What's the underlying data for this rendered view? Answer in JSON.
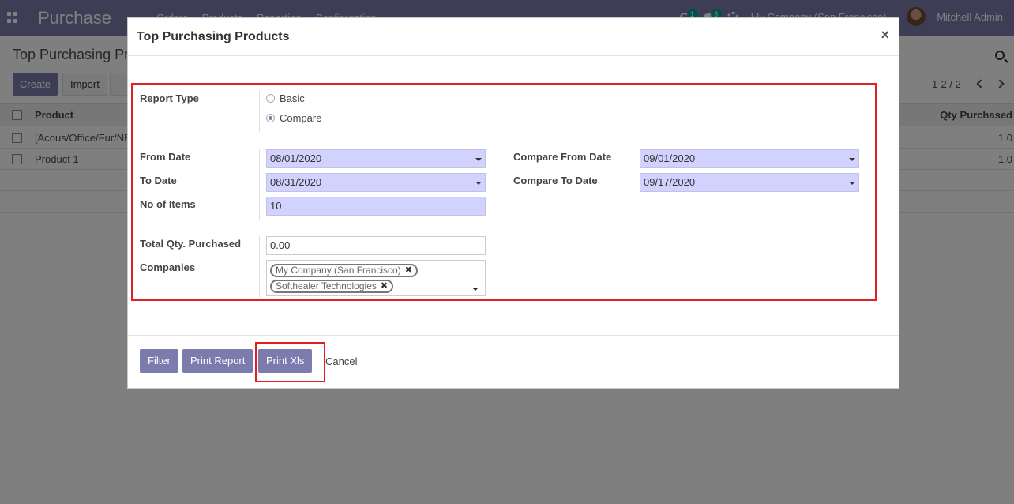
{
  "app": {
    "brand": "Purchase",
    "menu": [
      "Orders",
      "Products",
      "Reporting",
      "Configuration"
    ],
    "activity_count": "1",
    "message_count": "3",
    "company": "My Company (San Francisco)",
    "user": "Mitchell Admin"
  },
  "control_panel": {
    "title": "Top Purchasing Pr",
    "create_label": "Create",
    "import_label": "Import",
    "pager": "1-2 / 2"
  },
  "list": {
    "col_product": "Product",
    "col_qty": "Qty Purchased",
    "rows": [
      {
        "product": "[Acous/Office/Fur/NE",
        "qty": "1.0"
      },
      {
        "product": "Product 1",
        "qty": "1.0"
      }
    ]
  },
  "modal": {
    "title": "Top Purchasing Products",
    "close": "×",
    "report_type_label": "Report Type",
    "report_types": [
      "Basic",
      "Compare"
    ],
    "selected_report_type": "Compare",
    "from_date_label": "From Date",
    "from_date": "08/01/2020",
    "to_date_label": "To Date",
    "to_date": "08/31/2020",
    "no_items_label": "No of Items",
    "no_items": "10",
    "compare_from_label": "Compare From Date",
    "compare_from": "09/01/2020",
    "compare_to_label": "Compare To Date",
    "compare_to": "09/17/2020",
    "total_qty_label": "Total Qty. Purchased",
    "total_qty": "0.00",
    "companies_label": "Companies",
    "companies": [
      "My Company (San Francisco)",
      "Softhealer Technologies"
    ],
    "tag_remove": "✖",
    "buttons": {
      "filter": "Filter",
      "print_report": "Print Report",
      "print_xls": "Print Xls",
      "cancel": "Cancel"
    }
  },
  "colors": {
    "primary": "#7c7bad",
    "required_field": "#d2d2ff",
    "highlight": "#e02020"
  }
}
